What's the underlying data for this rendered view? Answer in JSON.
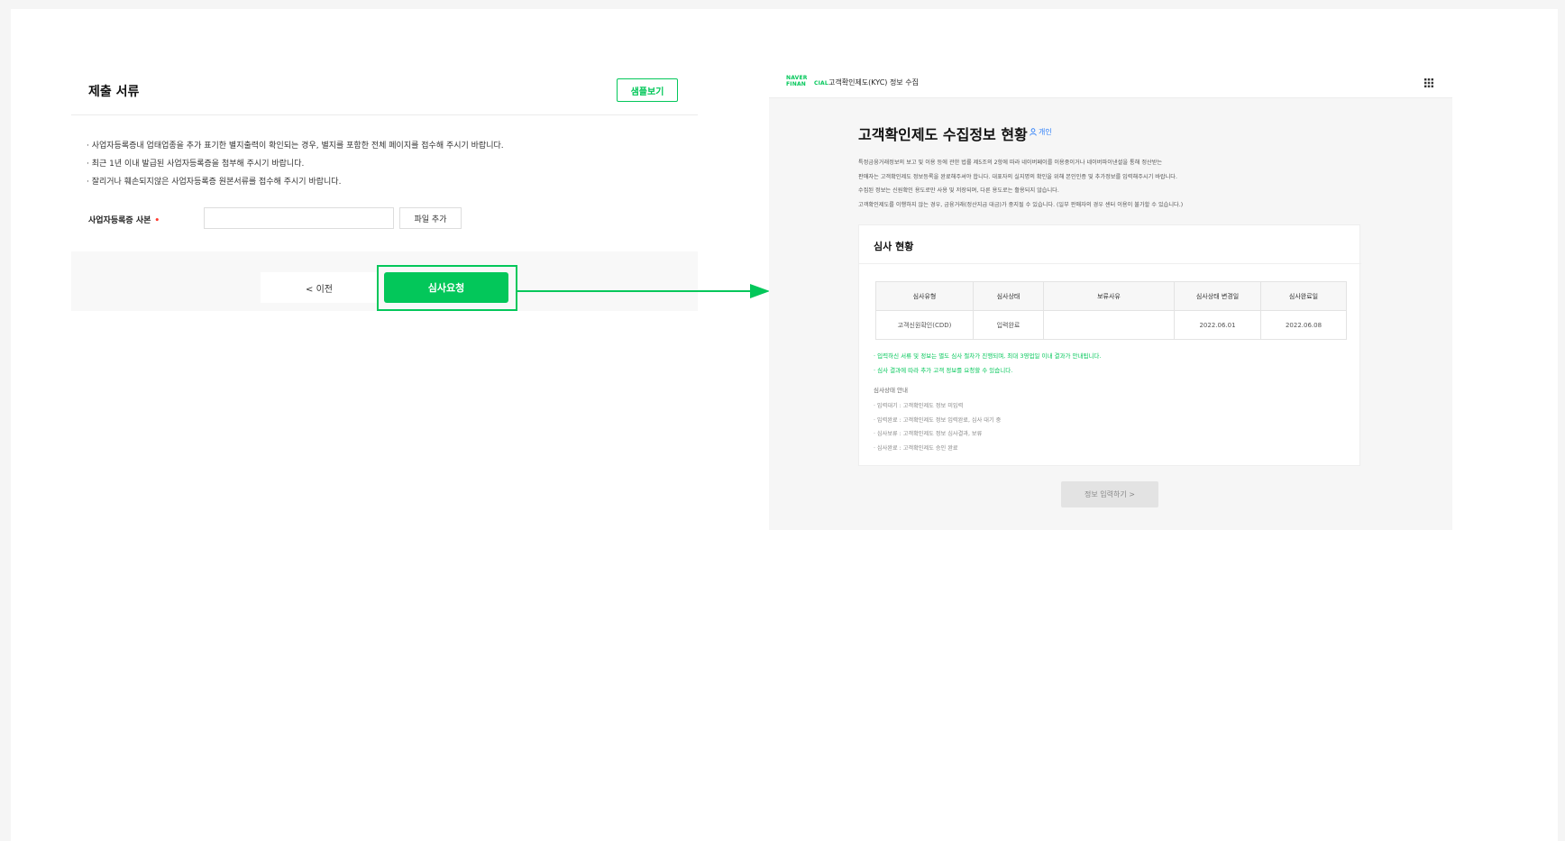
{
  "left": {
    "title": "제출 서류",
    "sample_button": "샘플보기",
    "notices": [
      "· 사업자등록증내 업태업종을 추가 표기한 별지출력이 확인되는 경우, 별지를 포함한 전체 페이지를 접수해 주시기 바랍니다.",
      "· 최근 1년 이내 발급된 사업자등록증을 첨부해 주시기 바랍니다.",
      "· 잘리거나 훼손되지않은 사업자등록증 원본서류를 접수해 주시기 바랍니다."
    ],
    "field_label": "사업자등록증 사본",
    "required_mark": "•",
    "file_input_value": "",
    "add_file_button": "파일 추가",
    "prev_button": "< 이전",
    "request_button": "심사요청"
  },
  "right": {
    "brand_line1": "NAVER",
    "brand_line2": "FINAN",
    "brand_suffix": "CIAL",
    "header_title": "고객확인제도(KYC) 정보 수집",
    "page_title": "고객확인제도 수집정보 현황",
    "badge_label": "개인",
    "description": [
      "특정금융거래정보의 보고 및 이용 등에 관한 법률 제5조의 2항에 따라 네이버페이를 이용중이거나 네이버파이낸셜을 통해 정산받는",
      "판매자는 고객확인제도 정보등록을 완료해주셔야 합니다. 대표자의 실지명의 확인을 위해 본인인증 및 추가정보를 입력해주시기 바랍니다.",
      "수집된 정보는 신원확인 용도로만 사용 및 저장되며, 다른 용도로는 활용되지 않습니다.",
      "고객확인제도를 이행하지 않는 경우, 금융거래(정산지급 대금)가 중지될 수 있습니다. (일부 판매자의 경우 센터 이용이 불가할 수 있습니다.)"
    ],
    "review_title": "심사 현황",
    "table": {
      "headers": [
        "심사유형",
        "심사상태",
        "보류사유",
        "심사상태 변경일",
        "심사완료일"
      ],
      "rows": [
        [
          "고객신원확인(CDD)",
          "입력완료",
          "",
          "2022.06.01",
          "2022.06.08"
        ]
      ]
    },
    "green_notes": [
      "· 입력하신 서류 및 정보는 별도 심사 절차가 진행되며, 최대 3영업일 이내 결과가 안내됩니다.",
      "· 심사 결과에 따라 추가 고객 정보를 요청할 수 있습니다."
    ],
    "status_guide_title": "심사상태 안내",
    "status_guide": [
      "· 입력대기 : 고객확인제도 정보 미입력",
      "· 입력완료 : 고객확인제도 정보 입력완료, 심사 대기 중",
      "· 심사보류 : 고객확인제도 정보 심사결과, 보류",
      "· 심사완료 : 고객확인제도 승인 완료"
    ],
    "info_button": "정보 입력하기 >"
  },
  "colors": {
    "accent": "#03c75a",
    "badge": "#2d7ff9",
    "required": "#ff3b30"
  },
  "icons": {
    "badge": "person-icon",
    "apps": "grid-icon",
    "flow": "arrow-right-icon"
  }
}
